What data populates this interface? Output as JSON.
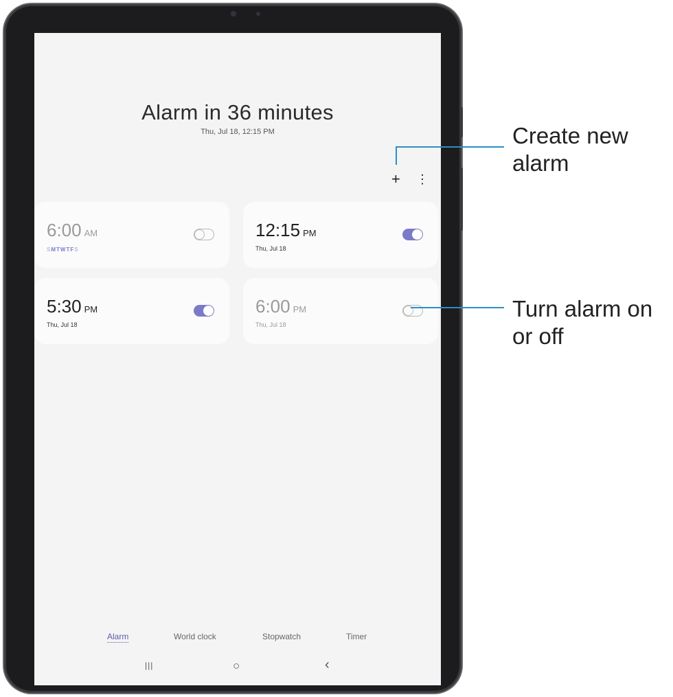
{
  "header": {
    "title": "Alarm in 36 minutes",
    "subtitle": "Thu, Jul 18, 12:15 PM"
  },
  "actions": {
    "add_icon": "plus-icon",
    "add_glyph": "+",
    "more_icon": "more-vertical-icon",
    "more_glyph": "⋮"
  },
  "alarms": [
    {
      "time": "6:00",
      "ampm": "AM",
      "repeat_days": [
        "S",
        "M",
        "T",
        "W",
        "T",
        "F",
        "S"
      ],
      "enabled": false
    },
    {
      "time": "12:15",
      "ampm": "PM",
      "date": "Thu, Jul 18",
      "enabled": true
    },
    {
      "time": "5:30",
      "ampm": "PM",
      "date": "Thu, Jul 18",
      "enabled": true
    },
    {
      "time": "6:00",
      "ampm": "PM",
      "date": "Thu, Jul 18",
      "enabled": false
    }
  ],
  "tabs": [
    {
      "label": "Alarm",
      "active": true
    },
    {
      "label": "World clock",
      "active": false
    },
    {
      "label": "Stopwatch",
      "active": false
    },
    {
      "label": "Timer",
      "active": false
    }
  ],
  "navbar": {
    "recents_glyph": "|||",
    "home_glyph": "○",
    "back_glyph": "‹"
  },
  "callouts": {
    "create_line1": "Create new",
    "create_line2": "alarm",
    "toggle_line1": "Turn alarm on",
    "toggle_line2": "or off"
  },
  "colors": {
    "accent": "#7b7ac9",
    "callout_line": "#2a8fc4",
    "screen_bg": "#f4f4f4"
  }
}
